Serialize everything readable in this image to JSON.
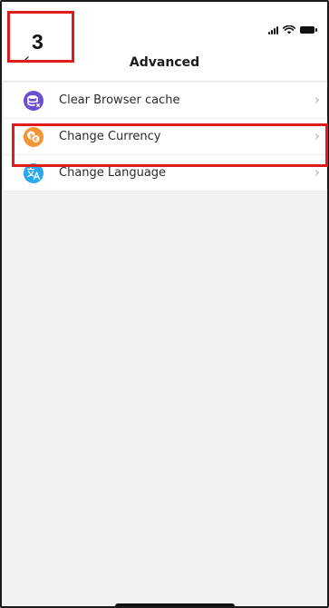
{
  "step": {
    "number": "3"
  },
  "nav": {
    "title": "Advanced",
    "back_icon": "chevron-left-icon"
  },
  "menu": {
    "items": [
      {
        "label": "Clear Browser cache",
        "icon": "database-clear-icon",
        "icon_color": "#6a4fd0"
      },
      {
        "label": "Change Currency",
        "icon": "currency-exchange-icon",
        "icon_color": "#f39533"
      },
      {
        "label": "Change Language",
        "icon": "translate-icon",
        "icon_color": "#2aa8ee"
      }
    ],
    "chevron": "›"
  },
  "colors": {
    "highlight": "#e01b1b",
    "background": "#f2f2f4"
  }
}
